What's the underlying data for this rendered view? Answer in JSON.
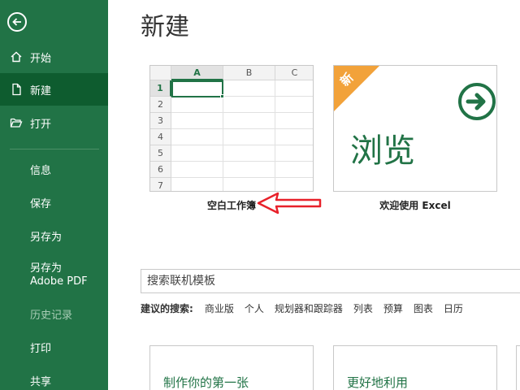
{
  "sidebar": {
    "back_icon": "back-arrow-icon",
    "items": [
      {
        "label": "开始",
        "icon": "home-icon"
      },
      {
        "label": "新建",
        "icon": "new-document-icon"
      },
      {
        "label": "打开",
        "icon": "folder-open-icon"
      },
      {
        "label": "信息"
      },
      {
        "label": "保存"
      },
      {
        "label": "另存为"
      },
      {
        "label": "另存为 Adobe PDF"
      },
      {
        "label": "历史记录"
      },
      {
        "label": "打印"
      },
      {
        "label": "共享"
      }
    ]
  },
  "main": {
    "title": "新建",
    "templates": [
      {
        "caption": "空白工作簿"
      },
      {
        "caption": "欢迎使用 Excel",
        "ribbon": "新",
        "big_text": "浏览"
      }
    ],
    "grid": {
      "columns": [
        "A",
        "B",
        "C"
      ],
      "rows": [
        "1",
        "2",
        "3",
        "4",
        "5",
        "6",
        "7"
      ]
    },
    "search": {
      "placeholder": "搜索联机模板"
    },
    "suggested": {
      "label": "建议的搜索:",
      "items": [
        "商业版",
        "个人",
        "规划器和跟踪器",
        "列表",
        "预算",
        "图表",
        "日历"
      ]
    },
    "more_templates": [
      {
        "title": "制作你的第一张"
      },
      {
        "title": "更好地利用"
      }
    ]
  },
  "colors": {
    "accent": "#217346",
    "active_nav": "#0e5c2f",
    "ribbon": "#f2a23a",
    "annotation": "#e8212a"
  }
}
